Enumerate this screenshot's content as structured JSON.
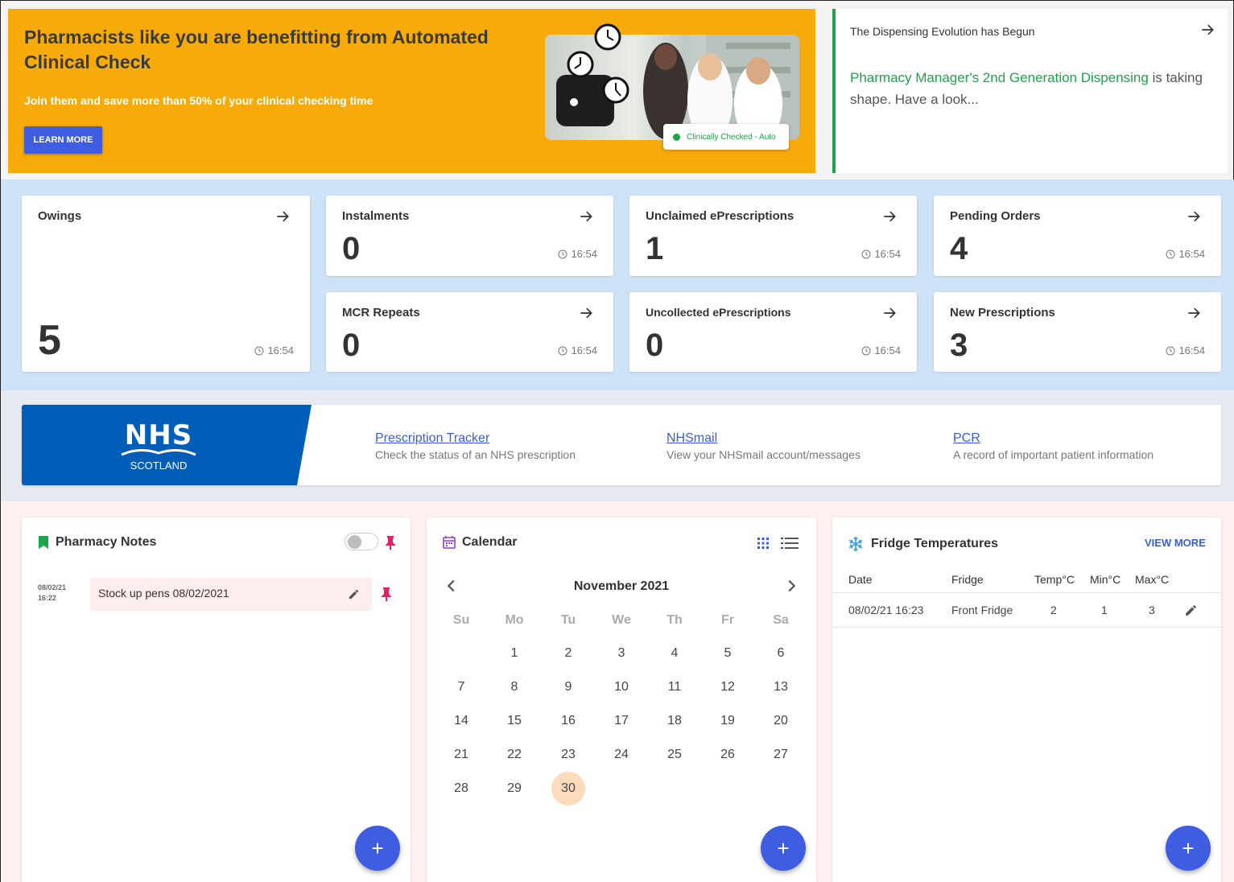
{
  "promo": {
    "title": "Pharmacists like you are benefitting from Automated Clinical Check",
    "subtitle": "Join them and save more than 50% of your clinical checking time",
    "button": "LEARN MORE",
    "badge": "Clinically Checked - Auto"
  },
  "evolution": {
    "title": "The Dispensing Evolution has Begun",
    "link": "Pharmacy Manager's 2nd Generation Dispensing",
    "text": " is taking shape. Have a look..."
  },
  "stats": [
    {
      "label": "Owings",
      "value": "5",
      "time": "16:54"
    },
    {
      "label": "Instalments",
      "value": "0",
      "time": "16:54"
    },
    {
      "label": "Unclaimed ePrescriptions",
      "value": "1",
      "time": "16:54"
    },
    {
      "label": "Pending Orders",
      "value": "4",
      "time": "16:54"
    },
    {
      "label": "MCR Repeats",
      "value": "0",
      "time": "16:54"
    },
    {
      "label": "Uncollected ePrescriptions",
      "value": "0",
      "time": "16:54"
    },
    {
      "label": "New Prescriptions",
      "value": "3",
      "time": "16:54"
    }
  ],
  "nhs": {
    "logo": "NHS",
    "logo_sub": "SCOTLAND",
    "links": [
      {
        "label": "Prescription Tracker",
        "desc": "Check the status of an NHS prescription"
      },
      {
        "label": "NHSmail",
        "desc": "View your NHSmail account/messages"
      },
      {
        "label": "PCR",
        "desc": "A record of important patient information"
      }
    ]
  },
  "notes": {
    "title": "Pharmacy Notes",
    "items": [
      {
        "date": "08/02/21",
        "time": "16:22",
        "text": "Stock up pens 08/02/2021"
      }
    ]
  },
  "calendar": {
    "title": "Calendar",
    "month": "November 2021",
    "weekdays": [
      "Su",
      "Mo",
      "Tu",
      "We",
      "Th",
      "Fr",
      "Sa"
    ],
    "weeks": [
      [
        "",
        "1",
        "2",
        "3",
        "4",
        "5",
        "6"
      ],
      [
        "7",
        "8",
        "9",
        "10",
        "11",
        "12",
        "13"
      ],
      [
        "14",
        "15",
        "16",
        "17",
        "18",
        "19",
        "20"
      ],
      [
        "21",
        "22",
        "23",
        "24",
        "25",
        "26",
        "27"
      ],
      [
        "28",
        "29",
        "30",
        "",
        "",
        "",
        ""
      ]
    ],
    "today": "30"
  },
  "fridge": {
    "title": "Fridge Temperatures",
    "view_more": "VIEW MORE",
    "columns": [
      "Date",
      "Fridge",
      "Temp°C",
      "Min°C",
      "Max°C"
    ],
    "rows": [
      [
        "08/02/21 16:23",
        "Front Fridge",
        "2",
        "1",
        "3"
      ]
    ]
  },
  "colors": {
    "accent": "#3f5de0",
    "promo": "#f6ab0b",
    "green": "#1ea44a",
    "nhs_blue": "#005eb8",
    "pin": "#e91e63"
  }
}
